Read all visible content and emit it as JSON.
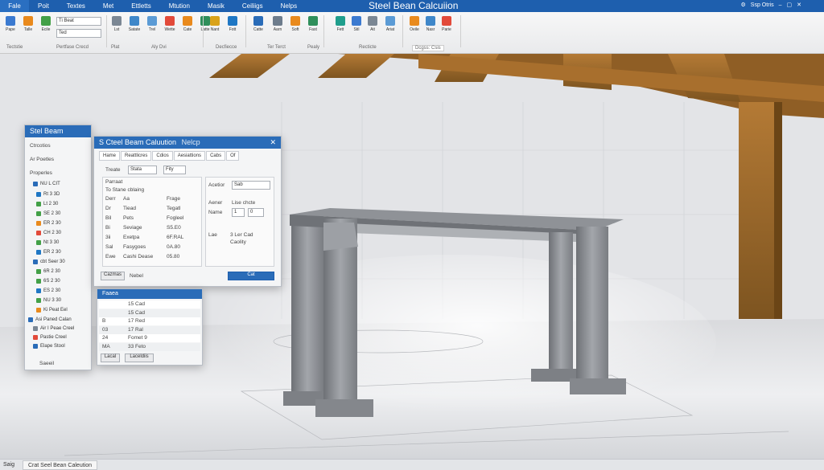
{
  "app": {
    "title": "Steel Bean Calcuiion"
  },
  "menu": {
    "file": "Fale",
    "items": [
      "Poit",
      "Textes",
      "Met",
      "Ettletts",
      "Mtution",
      "Masik",
      "Ceiliigs",
      "Nelps"
    ],
    "right": "Ssp Otris"
  },
  "ribbon": {
    "row1": [
      "Pape",
      "Talle",
      "Ecile",
      "Eall",
      "Lst",
      "Satate",
      "Trel",
      "Wette",
      "Cate",
      "Latte",
      "Nant",
      "Fott",
      "Catte",
      "Aarn",
      "Soft",
      "Fast",
      "Fett",
      "Stil",
      "Ait",
      "Ariat",
      "Oeile",
      "Nasr",
      "Parie",
      "Lade"
    ],
    "combo1": "Ti Beat",
    "combo2": "Ted",
    "groups": [
      "Tectstie",
      "Pertfase Crecd",
      "Plat",
      "Aly Dvi",
      "Decfiecce",
      "Ter Terct",
      "Pealy",
      "Recticte",
      "Dcgss: Csis"
    ]
  },
  "side_panel": {
    "title": "Stel Beam",
    "items": [
      "Ctrcotios",
      "Ar Poetles",
      "Properles"
    ],
    "tree": [
      "NU L CIT",
      "Rt 3 3D",
      "Lt 2 30",
      "SE 2 30",
      "ER 2 30",
      "CH 2 30",
      "Nt 3 30",
      "ER 2 30",
      "cbt Seer 30",
      "6R 2 30",
      "6S 2 30",
      "ES 2 30",
      "NU 3 30",
      "Ki Peat Eel",
      "Asi Paned Calan",
      "Air I Peae Creel",
      "Pastie Creel",
      "Elape Stool"
    ],
    "status": "Saeeil"
  },
  "dialog": {
    "title": "S Cteel Beam Caluution",
    "title2": "Nelcp",
    "tabs": [
      "Hame",
      "Reattlicres",
      "Cdios",
      "Aesiattions",
      "Cabs"
    ],
    "tab_extra": "Of",
    "treat_label": "Treate",
    "treat_value": "Stata",
    "fity_value": "Fity",
    "param_header": "Parraat",
    "param_sub": "To Stane cblaing",
    "rows": [
      {
        "a": "Derr",
        "b": "Aa",
        "c": "Frage"
      },
      {
        "a": "Dr",
        "b": "Tiead",
        "c": "Tegatl"
      },
      {
        "a": "Bil",
        "b": "Pets",
        "c": "Fogleel"
      },
      {
        "a": "Bi",
        "b": "Seviage",
        "c": "S5.E0"
      },
      {
        "a": "3ii",
        "b": "Exetpa",
        "c": "6F.RAL"
      },
      {
        "a": "Sal",
        "b": "Fasygoes",
        "c": "0A.80"
      },
      {
        "a": "Ewe",
        "b": "Cashi Dease",
        "c": "05.80"
      }
    ],
    "right_col": {
      "aceletor_label": "Acetior",
      "aceletor_value": "Sab",
      "acer_label": "Aener",
      "cheese_label": "Lise chcte",
      "name_label": "Name",
      "name_v1": "1",
      "name_v2": "0",
      "lar_label": "Lae",
      "lar_value": "3 Ler Cad",
      "lar_sub": "Caolity"
    },
    "footer_left": "Cazmas",
    "footer_mid": "Nebel",
    "ok": "Cat"
  },
  "lower_panel": {
    "header": "Faaea",
    "rows": [
      {
        "a": "",
        "b": "15 Cad"
      },
      {
        "a": "",
        "b": "15 Cad"
      },
      {
        "a": "B",
        "b": "17 Red"
      },
      {
        "a": "03",
        "b": "17 Ral"
      },
      {
        "a": "24",
        "b": "Fomet 9"
      },
      {
        "a": "MA",
        "b": "33 Feto"
      }
    ],
    "btn1": "Lacal",
    "btn2": "Laceldiis"
  },
  "statusbar": {
    "left": "Saig",
    "caption": "Crat Seel Bean Caleution"
  },
  "colors": {
    "accent": "#1e5fae",
    "panel_head": "#2a6cb8",
    "beam": "#8a8d92",
    "wood": "#9a6a2e"
  }
}
